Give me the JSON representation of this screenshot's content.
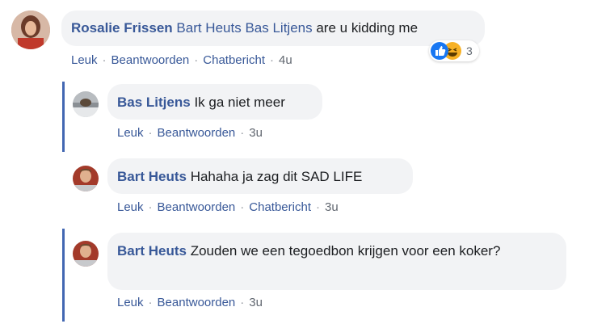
{
  "comment_main": {
    "author": "Rosalie Frissen",
    "tags": "Bart Heuts Bas Litjens",
    "text": "are u kidding me",
    "actions": [
      "Leuk",
      "Beantwoorden",
      "Chatbericht"
    ],
    "time": "4u",
    "reaction_count": "3",
    "reaction_icons": [
      "like-icon",
      "haha-icon"
    ]
  },
  "replies": [
    {
      "author": "Bas Litjens",
      "text": "Ik ga niet meer",
      "actions": [
        "Leuk",
        "Beantwoorden"
      ],
      "time": "3u"
    },
    {
      "author": "Bart Heuts",
      "text": "Hahaha ja zag dit SAD LIFE",
      "actions": [
        "Leuk",
        "Beantwoorden",
        "Chatbericht"
      ],
      "time": "3u"
    },
    {
      "author": "Bart Heuts",
      "text": "Zouden we een tegoedbon krijgen voor een koker?",
      "actions": [
        "Leuk",
        "Beantwoorden"
      ],
      "time": "3u"
    }
  ],
  "colors": {
    "link": "#385898",
    "bubble": "#f2f3f5",
    "thread_line": "#4267b2",
    "like": "#1877f2",
    "haha": "#f7b125"
  }
}
